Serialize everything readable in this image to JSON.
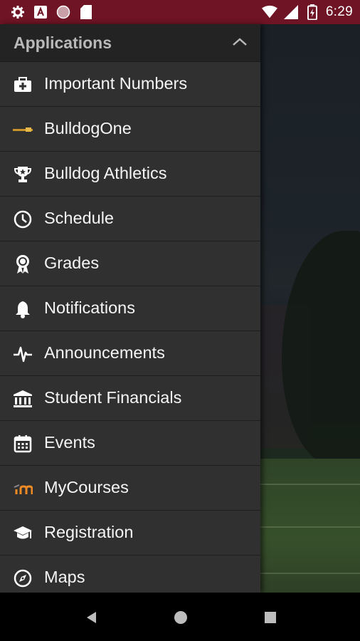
{
  "status_bar": {
    "time": "6:29",
    "background": "#6e1424",
    "left_icons": [
      "gear-icon",
      "text-a-icon",
      "circle-icon",
      "sd-card-icon"
    ],
    "right_icons": [
      "wifi-icon",
      "signal-icon",
      "battery-icon"
    ]
  },
  "drawer": {
    "header_title": "Applications",
    "items": [
      {
        "label": "Important Numbers",
        "icon": "first-aid-kit-icon"
      },
      {
        "label": "BulldogOne",
        "icon": "bulldogone-logo-icon"
      },
      {
        "label": "Bulldog Athletics",
        "icon": "trophy-icon"
      },
      {
        "label": "Schedule",
        "icon": "clock-icon"
      },
      {
        "label": "Grades",
        "icon": "award-ribbon-icon"
      },
      {
        "label": "Notifications",
        "icon": "bell-icon"
      },
      {
        "label": "Announcements",
        "icon": "pulse-icon"
      },
      {
        "label": "Student Financials",
        "icon": "bank-icon"
      },
      {
        "label": "Events",
        "icon": "calendar-icon"
      },
      {
        "label": "MyCourses",
        "icon": "moodle-logo-icon"
      },
      {
        "label": "Registration",
        "icon": "graduation-cap-icon"
      },
      {
        "label": "Maps",
        "icon": "compass-icon"
      }
    ]
  },
  "nav_bar": {
    "buttons": [
      "back-icon",
      "home-icon",
      "recents-icon"
    ]
  },
  "colors": {
    "accent": "#6e1424",
    "drawer_bg": "#303030",
    "header_bg": "#232323",
    "text": "#f5f5f5"
  }
}
